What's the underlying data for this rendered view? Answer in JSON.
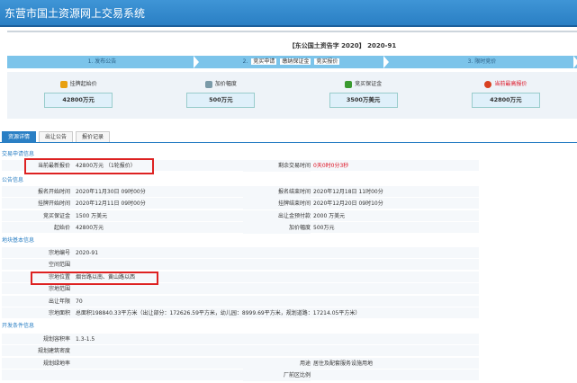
{
  "header": {
    "title": "东营市国土资源网上交易系统"
  },
  "doc_no": "【东公国土资告字 2020】 2020-91",
  "steps": {
    "s1": "1. 发布公告",
    "s2_num": "2.",
    "s2_tags": [
      "竞买申请",
      "缴纳保证金",
      "竞买报价"
    ],
    "s3": "3. 限时竞价"
  },
  "cards": [
    {
      "label": "挂牌起始价",
      "value": "42800万元",
      "color": "#e8a010"
    },
    {
      "label": "加价幅度",
      "value": "500万元",
      "color": "#7a9aa8"
    },
    {
      "label": "竞买保证金",
      "value": "3500万美元",
      "color": "#3a9a30"
    },
    {
      "label": "当前最高报价",
      "value": "42800万元",
      "color": "#d84020"
    }
  ],
  "tabs": [
    "资源详情",
    "出让公告",
    "报价记录"
  ],
  "sections": {
    "apply": "交易申请信息",
    "notice": "公告信息",
    "land": "地块基本信息",
    "dev": "开发条件信息"
  },
  "apply": {
    "l": "当前最新报价",
    "v": "42800万元 （1轮报价）",
    "l2": "剩余交易时间",
    "v2": "0天0时0分3秒"
  },
  "notice": [
    {
      "l": "报名开始时间",
      "v": "2020年11月30日 09时00分",
      "l2": "报名结束时间",
      "v2": "2020年12月18日 11时00分"
    },
    {
      "l": "挂牌开始时间",
      "v": "2020年12月11日 09时00分",
      "l2": "挂牌结束时间",
      "v2": "2020年12月20日 09时10分"
    },
    {
      "l": "竞买保证金",
      "v": "1500 万美元",
      "l2": "出让金预付款",
      "v2": "2000 万美元"
    },
    {
      "l": "起始价",
      "v": "42800万元",
      "l2": "加价幅度",
      "v2": "500万元"
    }
  ],
  "land": [
    {
      "l": "宗地编号",
      "v": "2020-91"
    },
    {
      "l": "空间范围",
      "v": ""
    },
    {
      "l": "宗地位置",
      "v": "烟台路以南、黄山路以西"
    },
    {
      "l": "宗地范围",
      "v": ""
    },
    {
      "l": "出让年限",
      "v": "70"
    },
    {
      "l": "宗地面积",
      "v": "总面积198840.33平方米（出让部分：172626.59平方米，幼儿园：8999.69平方米，规划道路：17214.05平方米）"
    }
  ],
  "dev": [
    {
      "l": "规划容积率",
      "v": "1.3-1.5"
    },
    {
      "l": "规划建筑密度",
      "v": ""
    },
    {
      "l": "规划绿地率",
      "v": "",
      "l2": "用途",
      "v2": "居住及配套服务设施用地"
    },
    {
      "l": "",
      "v": "",
      "l2": "厂前区比例",
      "v2": ""
    }
  ]
}
